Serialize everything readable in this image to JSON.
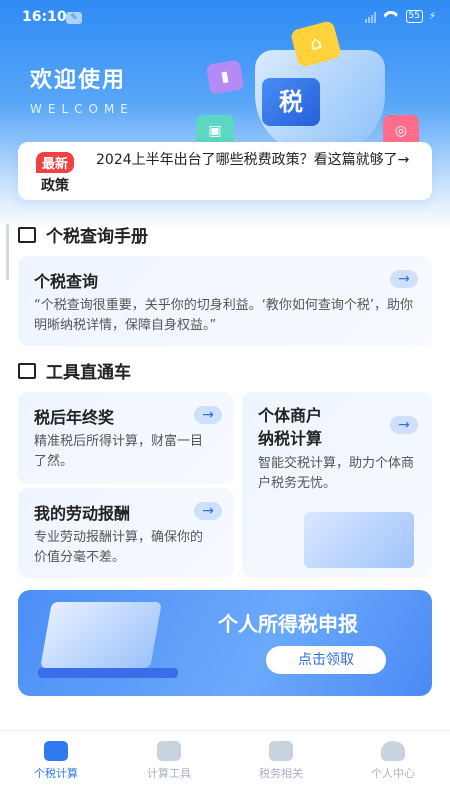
{
  "status_bar": {
    "time": "16:10",
    "battery": "55"
  },
  "hero": {
    "title": "欢迎使用",
    "subtitle": "WELCOME",
    "tax_glyph": "税"
  },
  "news": {
    "badge_top": "最新",
    "badge_bottom": "政策",
    "text": "2024上半年出台了哪些税费政策？看这篇就够了→"
  },
  "section_handbook": {
    "title": "个税查询手册",
    "card": {
      "title": "个税查询",
      "desc": "“个税查询很重要，关乎你的切身利益。‘教你如何查询个税’，助你明晰纳税详情，保障自身权益。”"
    }
  },
  "section_tools": {
    "title": "工具直通车",
    "cards": [
      {
        "title": "税后年终奖",
        "desc": "精准税后所得计算，财富一目了然。"
      },
      {
        "title": "个体商户\n纳税计算",
        "desc": "智能交税计算，助力个体商户税务无忧。"
      },
      {
        "title": "我的劳动报酬",
        "desc": "专业劳动报酬计算，确保你的价值分毫不差。"
      }
    ]
  },
  "banner": {
    "title": "个人所得税申报",
    "button": "点击领取"
  },
  "tabs": [
    {
      "label": "个税计算",
      "icon": "tax-calc-icon",
      "active": true
    },
    {
      "label": "计算工具",
      "icon": "calculator-icon",
      "active": false
    },
    {
      "label": "税务相关",
      "icon": "chart-icon",
      "active": false
    },
    {
      "label": "个人中心",
      "icon": "person-icon",
      "active": false
    }
  ],
  "colors": {
    "primary": "#2f7af0",
    "badge_red": "#ef4141"
  }
}
